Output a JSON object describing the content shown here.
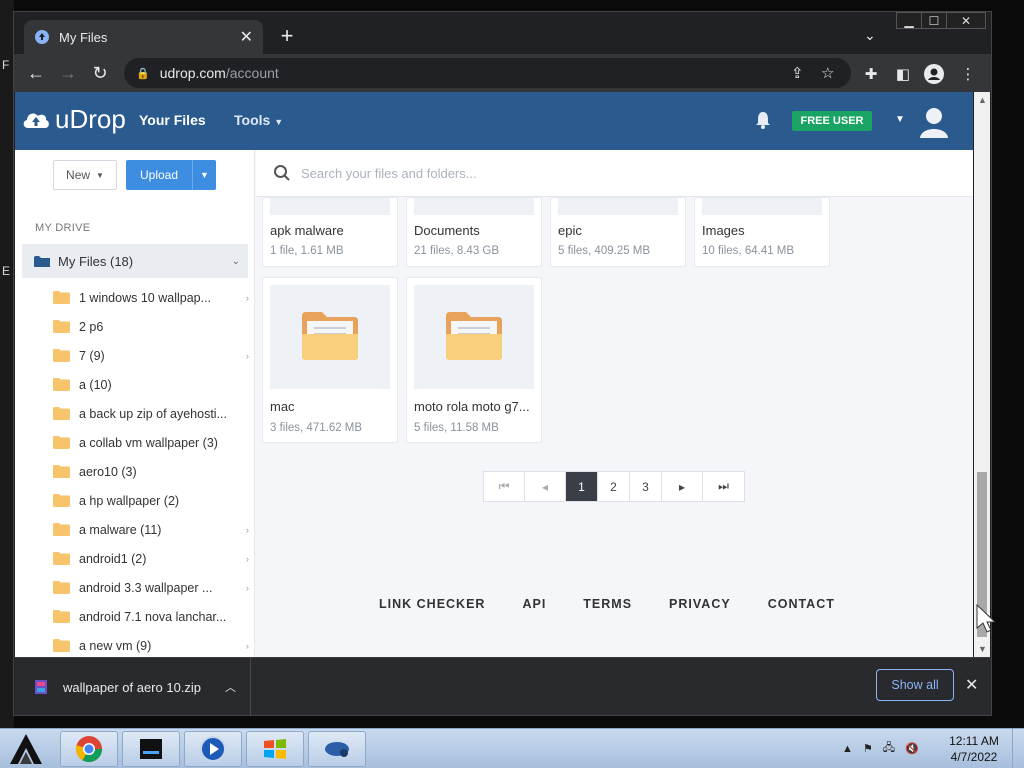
{
  "desktop": {
    "glyphs": [
      "F",
      "E"
    ]
  },
  "browser": {
    "tab_title": "My Files",
    "url_host": "udrop.com",
    "url_path": "/account"
  },
  "app": {
    "logo_text": "uDrop",
    "nav": {
      "your_files": "Your Files",
      "tools": "Tools"
    },
    "user_badge": "FREE USER",
    "colors": {
      "header": "#2b5a8f",
      "accent": "#3d8ee0",
      "badge": "#19a463"
    }
  },
  "sidebar": {
    "new_label": "New",
    "upload_label": "Upload",
    "section_label": "MY DRIVE",
    "root_label": "My Files (18)",
    "items": [
      {
        "label": "1 windows 10 wallpap...",
        "has_children": true
      },
      {
        "label": "2 p6",
        "has_children": false
      },
      {
        "label": "7 (9)",
        "has_children": true
      },
      {
        "label": "a (10)",
        "has_children": false
      },
      {
        "label": "a back up zip of ayehosti...",
        "has_children": false
      },
      {
        "label": "a collab vm wallpaper (3)",
        "has_children": false
      },
      {
        "label": "aero10 (3)",
        "has_children": false
      },
      {
        "label": "a hp wallpaper (2)",
        "has_children": false
      },
      {
        "label": "a malware (11)",
        "has_children": true
      },
      {
        "label": "android1 (2)",
        "has_children": true
      },
      {
        "label": "android 3.3 wallpaper ...",
        "has_children": true
      },
      {
        "label": "android 7.1 nova lanchar...",
        "has_children": false
      },
      {
        "label": "a new vm (9)",
        "has_children": true
      }
    ]
  },
  "content": {
    "search_placeholder": "Search your files and folders...",
    "folders": [
      {
        "name": "apk malware",
        "meta": "1 file, 1.61 MB"
      },
      {
        "name": "Documents",
        "meta": "21 files, 8.43 GB"
      },
      {
        "name": "epic",
        "meta": "5 files, 409.25 MB"
      },
      {
        "name": "Images",
        "meta": "10 files, 64.41 MB"
      },
      {
        "name": "mac",
        "meta": "3 files, 471.62 MB"
      },
      {
        "name": "moto rola moto g7...",
        "meta": "5 files, 11.58 MB"
      }
    ],
    "pagination": {
      "pages": [
        "1",
        "2",
        "3"
      ],
      "current": "1"
    },
    "footer_links": [
      "LINK CHECKER",
      "API",
      "TERMS",
      "PRIVACY",
      "CONTACT"
    ]
  },
  "download_shelf": {
    "file_name": "wallpaper of aero 10.zip",
    "show_all_label": "Show all"
  },
  "taskbar": {
    "time": "12:11 AM",
    "date": "4/7/2022"
  }
}
